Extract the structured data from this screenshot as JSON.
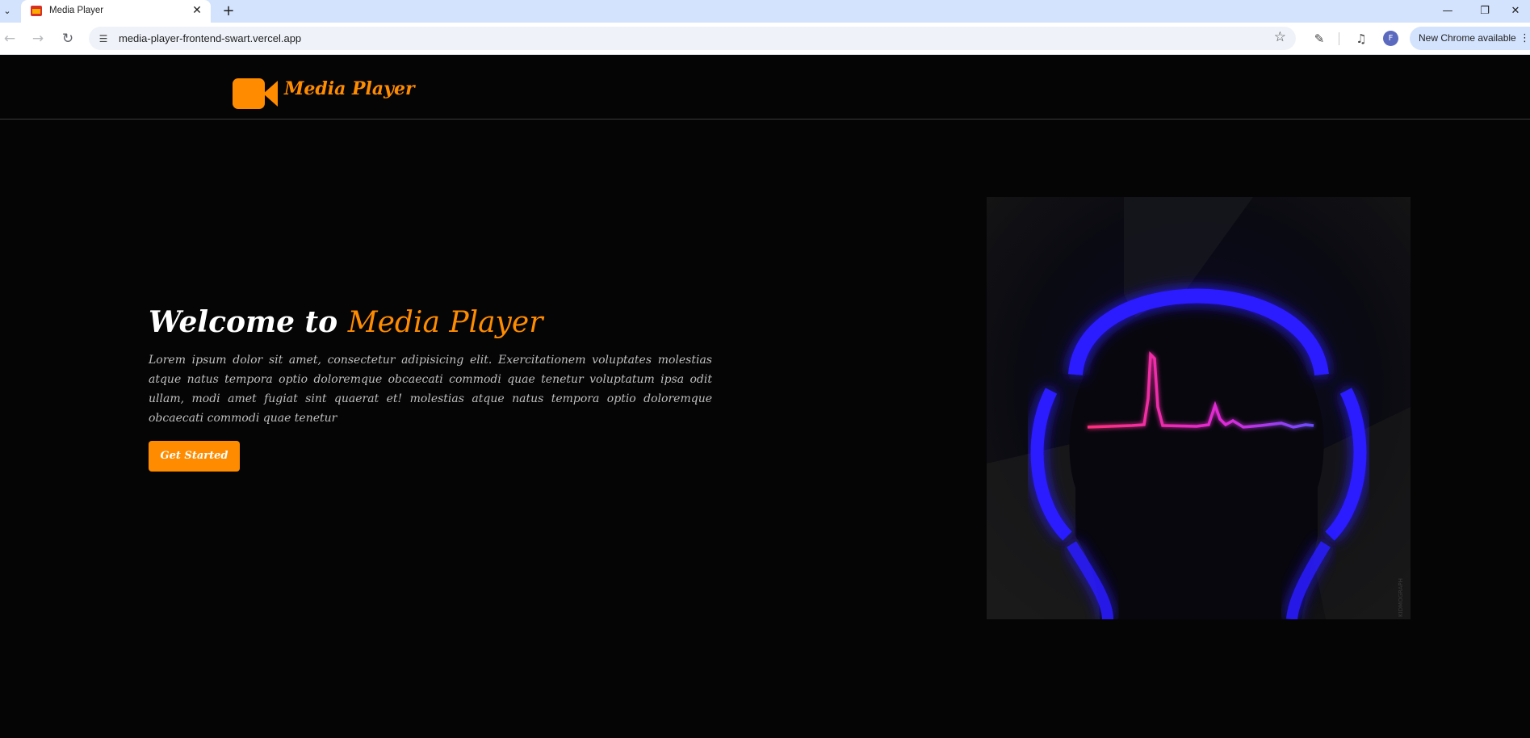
{
  "browser": {
    "tab_title": "Media Player",
    "url": "media-player-frontend-swart.vercel.app",
    "profile_initial": "F",
    "update_label": "New Chrome available"
  },
  "icons": {
    "tab_list": "chevron-down-icon",
    "favicon": "clapperboard-icon",
    "close": "close-icon",
    "new_tab": "plus-icon",
    "back": "arrow-left-icon",
    "forward": "arrow-right-icon",
    "reload": "reload-icon",
    "site_info": "tune-icon",
    "bookmark": "star-icon",
    "extensions": "puzzle-icon",
    "media": "media-controls-icon",
    "menu": "kebab-menu-icon",
    "logo": "video-camera-icon"
  },
  "site": {
    "brand": "Media Player",
    "hero": {
      "title_prefix": "Welcome to ",
      "title_accent": "Media Player",
      "paragraph": "Lorem ipsum dolor sit amet, consectetur adipisicing elit. Exercitationem voluptates molestias atque natus tempora optio doloremque obcaecati commodi quae tenetur voluptatum ipsa odit ullam, modi amet fugiat sint quaerat et! molestias atque natus tempora optio doloremque obcaecati commodi quae tenetur",
      "cta_label": "Get Started",
      "image_watermark": "KIDMOGRAPH"
    }
  },
  "colors": {
    "accent": "#ff8c00",
    "background": "#050505",
    "headphone_glow": "#2a1cff",
    "pulse": "#ff2f8e"
  }
}
